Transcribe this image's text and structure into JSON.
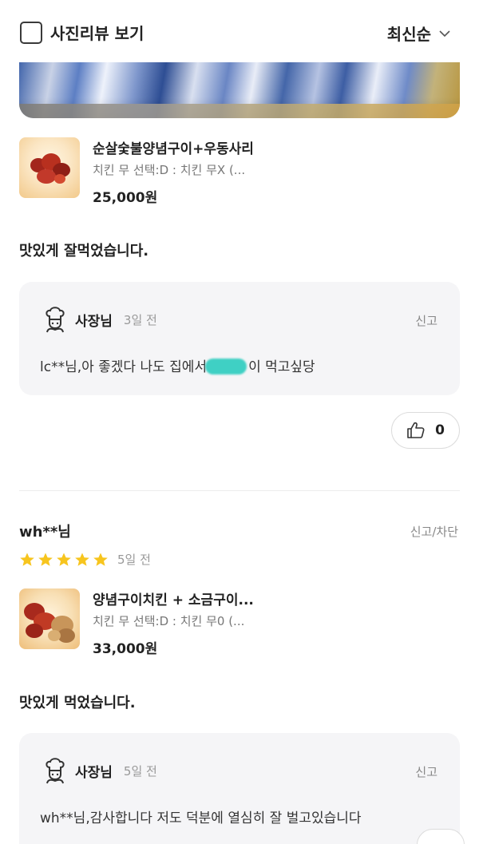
{
  "filter_bar": {
    "photo_review_label": "사진리뷰 보기",
    "sort_label": "최신순",
    "sort_icon": "chevron-down-icon"
  },
  "reviews": [
    {
      "photo": "review-photo",
      "menu": {
        "name": "순살숯불양념구이+우동사리",
        "option": "치킨 무 선택:D : 치킨 무X (...",
        "price": "25,000원"
      },
      "text": "맛있게 잘먹었습니다.",
      "owner_reply": {
        "name": "사장님",
        "date": "3일 전",
        "report": "신고",
        "text_before": "lc**님,아 좋겠다 나도 집에서",
        "text_after": "이 먹고싶당"
      },
      "likes": {
        "count": "0",
        "icon": "thumbs-up-icon"
      }
    },
    {
      "user": "wh**님",
      "report_block": "신고/차단",
      "rating": 5,
      "date": "5일 전",
      "menu": {
        "name": "양념구이치킨 + 소금구이...",
        "option": "치킨 무 선택:D : 치킨 무0 (...",
        "price": "33,000원"
      },
      "text": "맛있게 먹었습니다.",
      "owner_reply": {
        "name": "사장님",
        "date": "5일 전",
        "report": "신고",
        "text": "wh**님,감사합니다 저도 덕분에 열심히 잘 벌고있습니다"
      }
    }
  ],
  "colors": {
    "star": "#f7c51e",
    "owner_box": "#f5f5f7",
    "censor": "#3fd0c4"
  }
}
